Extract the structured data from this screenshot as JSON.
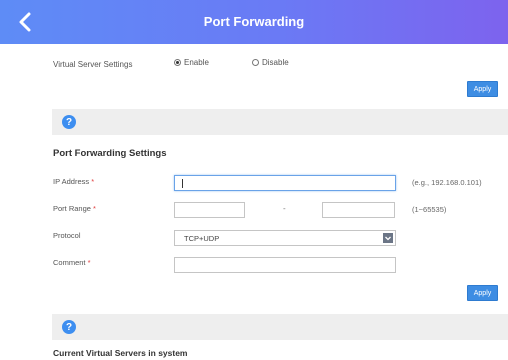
{
  "header": {
    "title": "Port Forwarding",
    "back_icon": "chevron-left-icon"
  },
  "virtual_server": {
    "label": "Virtual Server Settings",
    "options": [
      {
        "label": "Enable",
        "selected": true
      },
      {
        "label": "Disable",
        "selected": false
      }
    ]
  },
  "buttons": {
    "apply_label": "Apply"
  },
  "help": {
    "icon": "help-icon",
    "glyph": "?"
  },
  "port_forwarding": {
    "title": "Port Forwarding Settings",
    "ip_address": {
      "label": "IP Address",
      "value": "",
      "hint": "(e.g., 192.168.0.101)"
    },
    "port_range": {
      "label": "Port Range",
      "start": "",
      "end": "",
      "separator": "-",
      "hint": "(1~65535)"
    },
    "protocol": {
      "label": "Protocol",
      "selected": "TCP+UDP"
    },
    "comment": {
      "label": "Comment",
      "value": ""
    },
    "required_mark": "*"
  },
  "current_servers": {
    "title": "Current Virtual Servers in system"
  },
  "colors": {
    "header_gradient_start": "#5e8cf6",
    "header_gradient_end": "#7d63ee",
    "apply_button": "#3e8de3",
    "help_icon": "#3d8ef0",
    "band": "#eeeeee"
  }
}
